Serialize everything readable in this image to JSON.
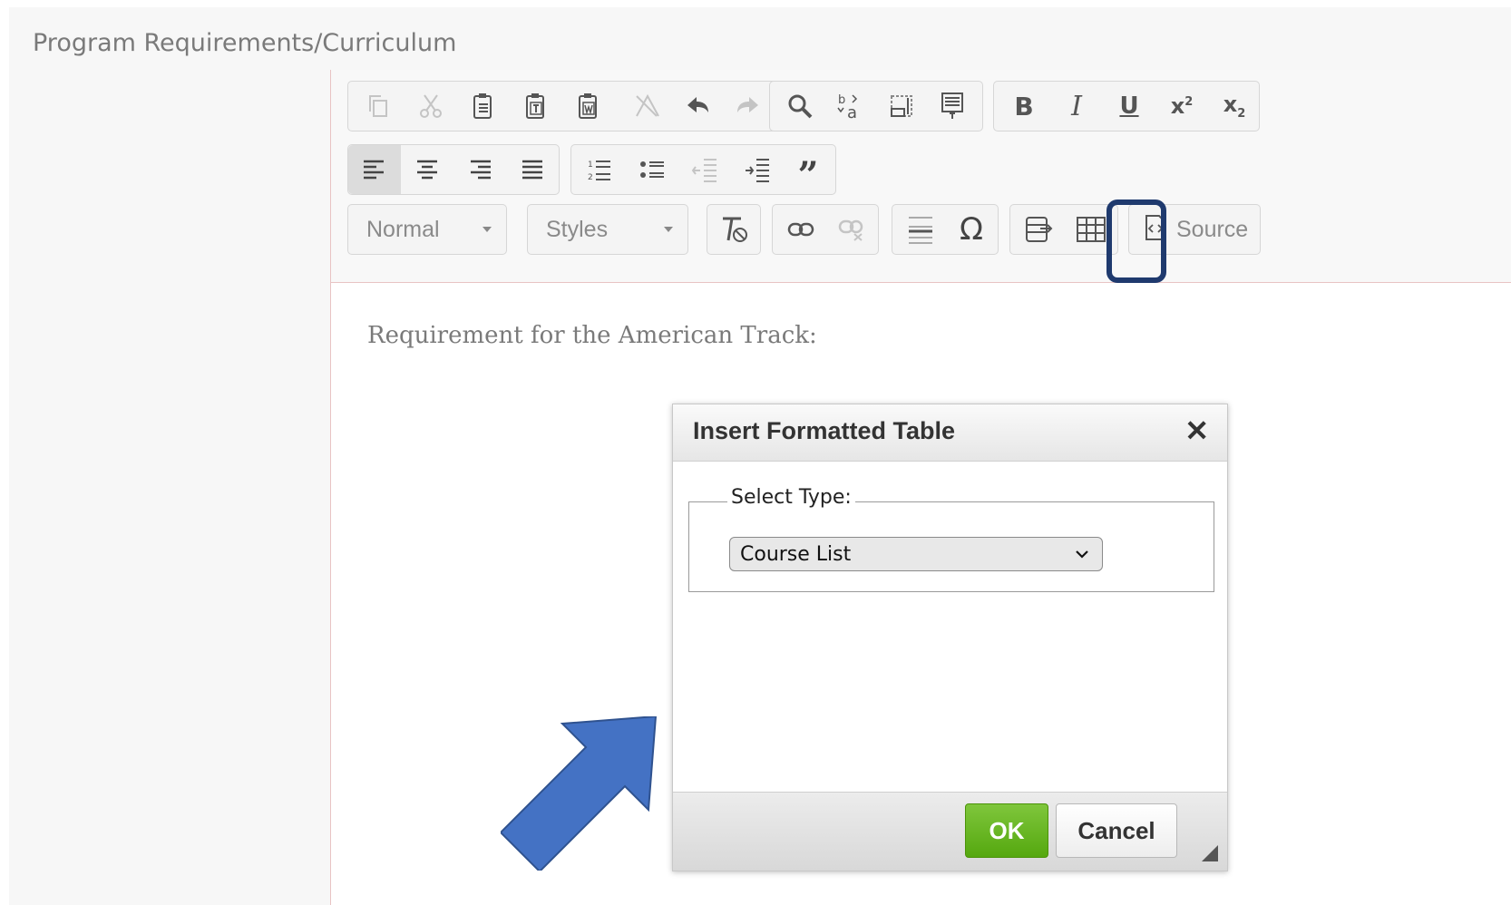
{
  "field": {
    "label": "Program Requirements/Curriculum"
  },
  "toolbar": {
    "format_combo": "Normal",
    "styles_combo": "Styles",
    "source_label": "Source"
  },
  "editor": {
    "content": "Requirement for the American Track:"
  },
  "dialog": {
    "title": "Insert Formatted Table",
    "close_glyph": "✕",
    "legend": "Select Type:",
    "select_value": "Course List",
    "ok_label": "OK",
    "cancel_label": "Cancel"
  },
  "colors": {
    "ok": "#5cb317",
    "highlight": "#1f3a6e",
    "arrow": "#4472c4"
  },
  "icons": [
    "copy-icon",
    "cut-icon",
    "paste-icon",
    "paste-text-icon",
    "paste-word-icon",
    "remove-format-icon",
    "undo-icon",
    "redo-icon",
    "find-icon",
    "replace-icon",
    "select-all-icon",
    "scayt-icon",
    "bold-icon",
    "italic-icon",
    "underline-icon",
    "superscript-icon",
    "subscript-icon",
    "align-left-icon",
    "align-center-icon",
    "align-right-icon",
    "justify-icon",
    "numbered-list-icon",
    "bulleted-list-icon",
    "outdent-icon",
    "indent-icon",
    "blockquote-icon",
    "clear-format-icon",
    "link-icon",
    "unlink-icon",
    "horizontal-rule-icon",
    "special-char-icon",
    "template-icon",
    "table-icon",
    "source-icon"
  ]
}
